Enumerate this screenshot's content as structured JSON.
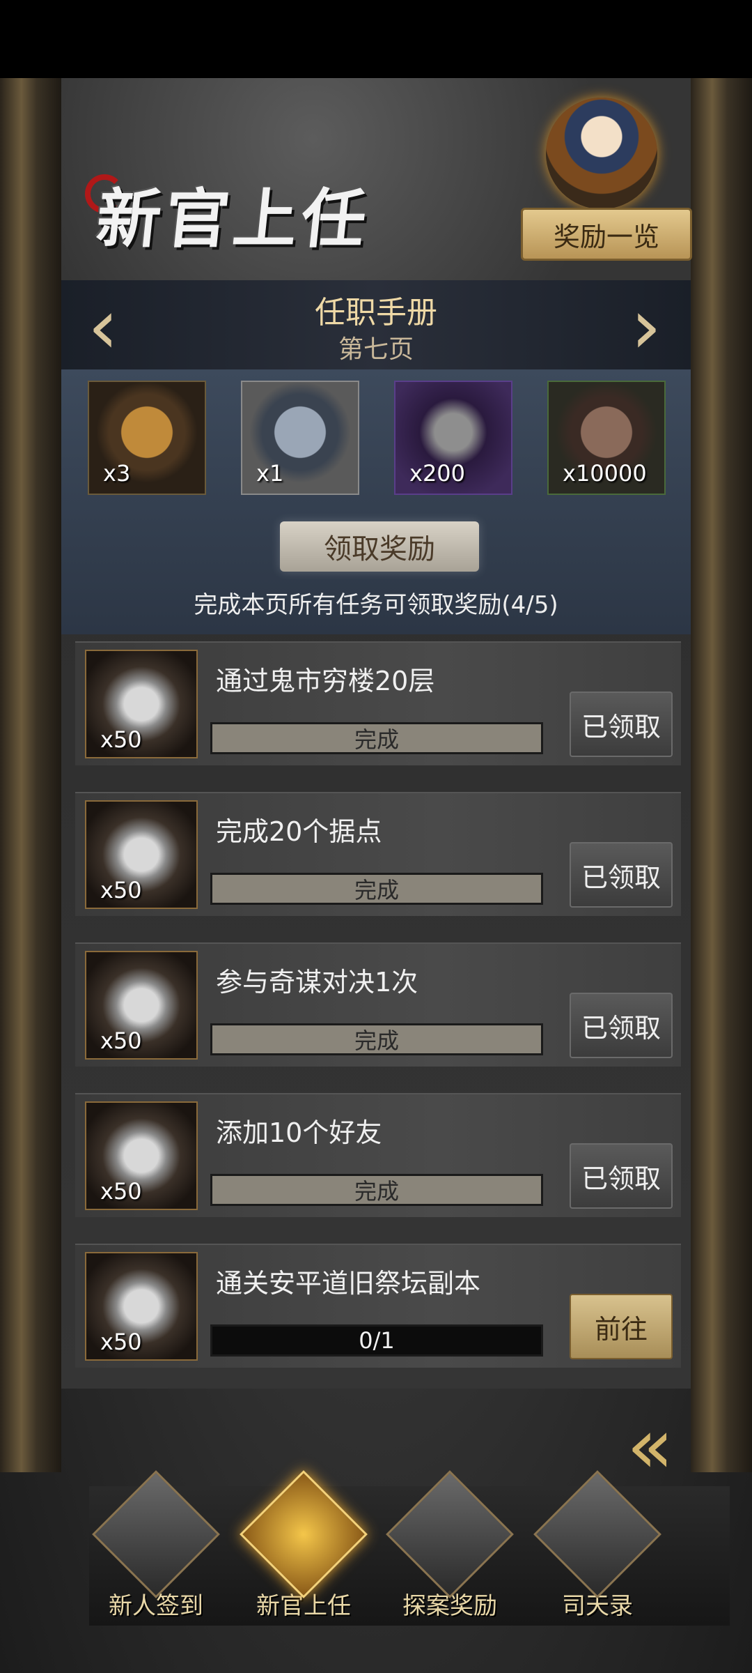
{
  "header": {
    "banner_title": "新官上任",
    "reward_list_button": "奖励一览"
  },
  "handbook": {
    "title": "任职手册",
    "page": "第七页",
    "prev_arrow": "‹",
    "next_arrow": "›"
  },
  "page_rewards": [
    {
      "icon": "money-pouch-icon",
      "count": "x3"
    },
    {
      "icon": "jade-disc-icon",
      "count": "x1"
    },
    {
      "icon": "ore-stone-icon",
      "count": "x200"
    },
    {
      "icon": "copper-coin-icon",
      "count": "x10000"
    }
  ],
  "claim_button": "领取奖励",
  "complete_note": "完成本页所有任务可领取奖励(4/5)",
  "tasks": [
    {
      "name": "通过鬼市穷楼20层",
      "reward_count": "x50",
      "progress_text": "完成",
      "progress": 1.0,
      "action": "已领取"
    },
    {
      "name": "完成20个据点",
      "reward_count": "x50",
      "progress_text": "完成",
      "progress": 1.0,
      "action": "已领取"
    },
    {
      "name": "参与奇谋对决1次",
      "reward_count": "x50",
      "progress_text": "完成",
      "progress": 1.0,
      "action": "已领取"
    },
    {
      "name": "添加10个好友",
      "reward_count": "x50",
      "progress_text": "完成",
      "progress": 1.0,
      "action": "已领取"
    },
    {
      "name": "通关安平道旧祭坛副本",
      "reward_count": "x50",
      "progress_text": "0/1",
      "progress": 0.0,
      "action": "前往"
    }
  ],
  "collapse_arrow": "«",
  "nav": [
    {
      "label": "新人签到",
      "icon": "sign-in-book-icon",
      "active": false
    },
    {
      "label": "新官上任",
      "icon": "golden-beast-icon",
      "active": true
    },
    {
      "label": "探案奖励",
      "icon": "treasure-box-icon",
      "active": false
    },
    {
      "label": "司天录",
      "icon": "bronze-censer-icon",
      "active": false
    }
  ]
}
